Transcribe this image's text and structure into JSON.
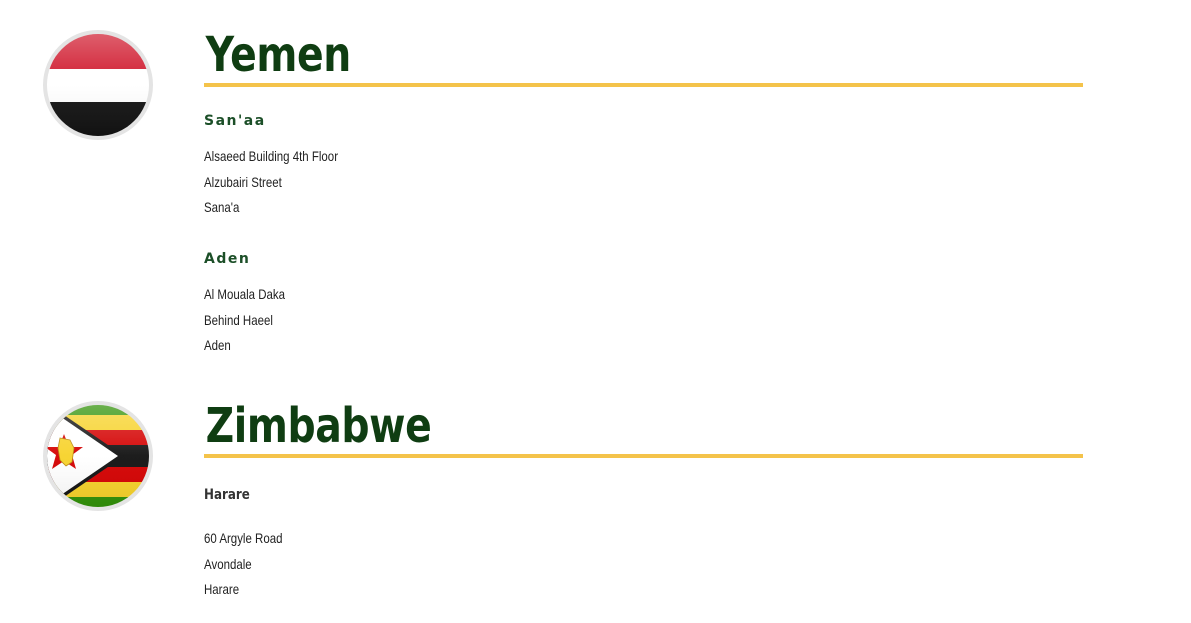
{
  "countries": [
    {
      "name": "Yemen",
      "flag": "yemen-flag-icon",
      "offices": [
        {
          "city": "San'aa",
          "address": [
            "Alsaeed Building 4th Floor",
            "Alzubairi Street",
            "Sana'a"
          ]
        },
        {
          "city": "Aden",
          "address": [
            "Al Mouala Daka",
            "Behind Haeel",
            "Aden"
          ]
        }
      ]
    },
    {
      "name": "Zimbabwe",
      "flag": "zimbabwe-flag-icon",
      "offices": [
        {
          "city": "Harare",
          "address": [
            "60 Argyle Road",
            "Avondale",
            "Harare"
          ]
        }
      ]
    }
  ],
  "colors": {
    "heading": "#0f3d12",
    "rule": "#f4c34a",
    "city": "#1c4f28"
  }
}
